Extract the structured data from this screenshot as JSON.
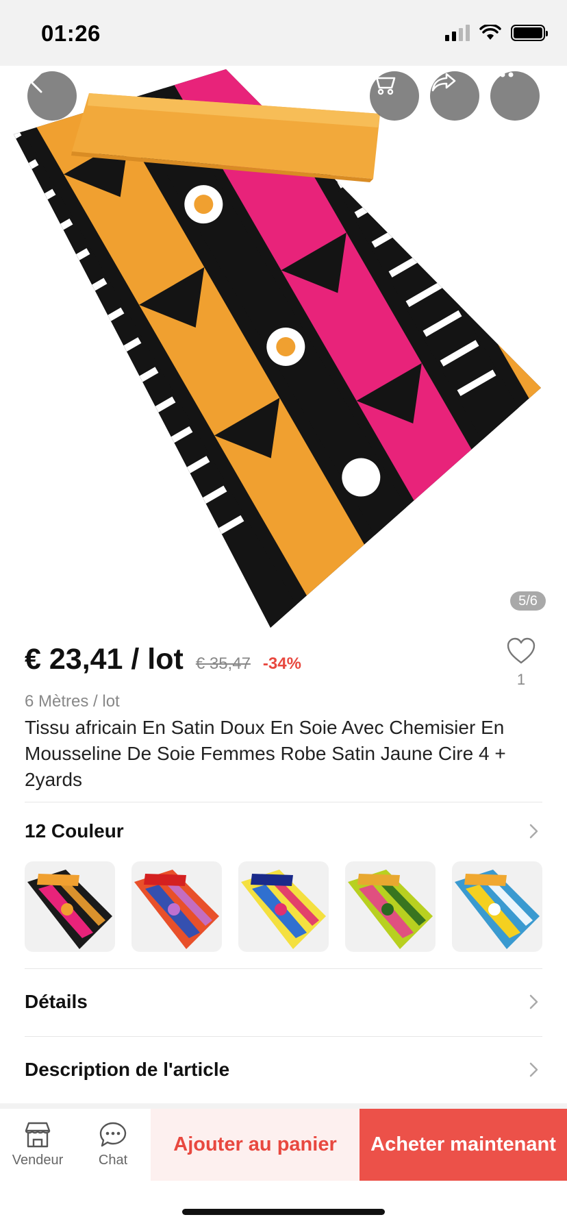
{
  "status_bar": {
    "time": "01:26"
  },
  "gallery": {
    "counter": "5/6"
  },
  "price": {
    "current": "€ 23,41 / lot",
    "original": "€ 35,47",
    "discount": "-34%"
  },
  "wishlist": {
    "count": "1"
  },
  "product": {
    "unit": "6 Mètres / lot",
    "title": "Tissu africain En Satin Doux En Soie Avec Chemisier En Mousseline De Soie Femmes Robe Satin Jaune Cire 4 + 2yards"
  },
  "colors": {
    "label": "12 Couleur",
    "swatches": [
      {
        "base": "#1a1a1a",
        "accent": "#e8237a",
        "accent2": "#f0a030",
        "top": "#f0a030"
      },
      {
        "base": "#e8502a",
        "accent": "#3550b0",
        "accent2": "#c070d0",
        "top": "#d42020"
      },
      {
        "base": "#f4e040",
        "accent": "#3070d0",
        "accent2": "#e03070",
        "top": "#1a2a8a"
      },
      {
        "base": "#b8d020",
        "accent": "#e05080",
        "accent2": "#2a6a20",
        "top": "#e8a830"
      },
      {
        "base": "#3a9ad0",
        "accent": "#f4d020",
        "accent2": "#ffffff",
        "top": "#f0a830"
      }
    ]
  },
  "sections": {
    "details": "Détails",
    "description": "Description de l'article"
  },
  "bottom_bar": {
    "seller": "Vendeur",
    "chat": "Chat",
    "add_to_cart": "Ajouter au panier",
    "buy_now": "Acheter maintenant"
  },
  "theme": {
    "accent": "#ec5149",
    "accent_light": "#fdf0ef"
  }
}
